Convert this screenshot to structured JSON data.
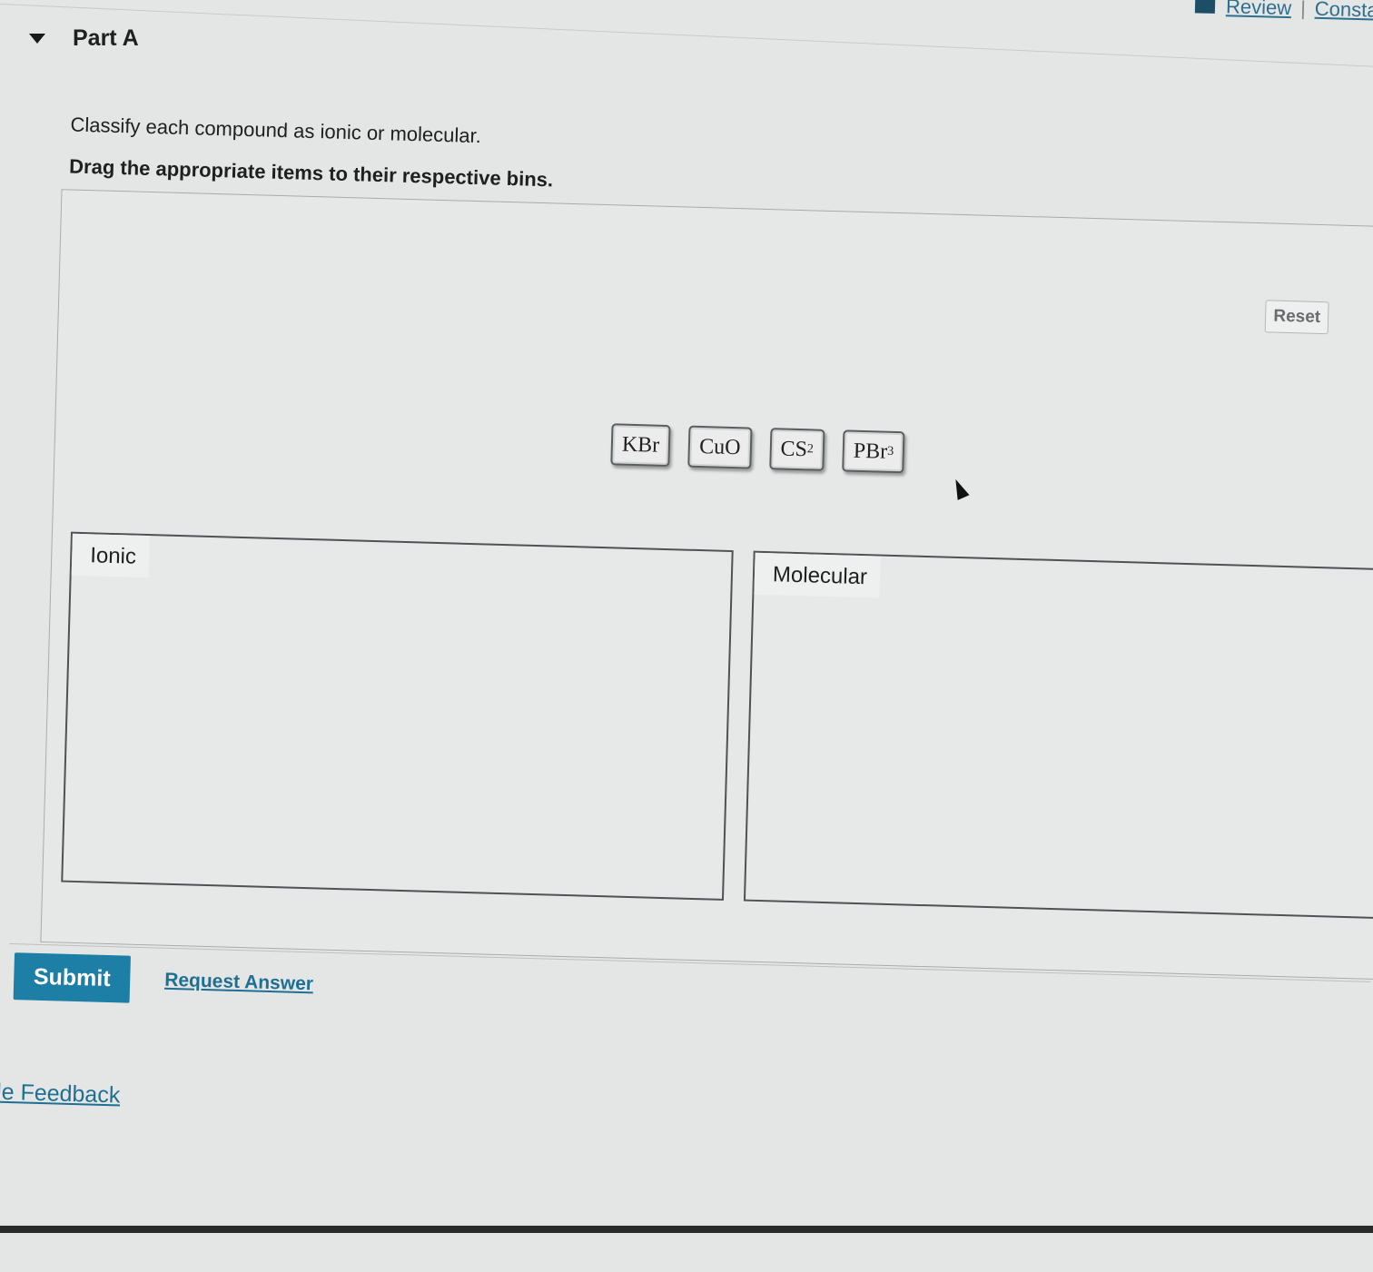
{
  "header": {
    "links": [
      "Review",
      "Consta"
    ],
    "separator": "|",
    "part_title": "Part A"
  },
  "question": {
    "prompt": "Classify each compound as ionic or molecular.",
    "instruction": "Drag the appropriate items to their respective bins.",
    "reset_label": "Reset",
    "tokens": [
      {
        "base": "KBr",
        "sub": ""
      },
      {
        "base": "CuO",
        "sub": ""
      },
      {
        "base": "CS",
        "sub": "2"
      },
      {
        "base": "PBr",
        "sub": "3"
      }
    ],
    "bins": [
      {
        "label": "Ionic"
      },
      {
        "label": "Molecular"
      }
    ]
  },
  "actions": {
    "submit_label": "Submit",
    "request_answer_label": "Request Answer"
  },
  "footer": {
    "feedback_label": "vide Feedback"
  },
  "colors": {
    "submit_bg": "#1d7fa6",
    "link": "#1f6f92"
  }
}
